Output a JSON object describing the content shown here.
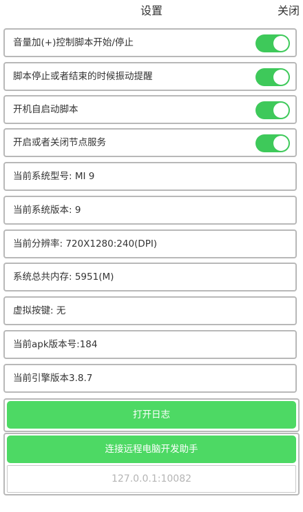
{
  "header": {
    "title": "设置",
    "close_label": "关闭"
  },
  "settings": {
    "toggles": [
      {
        "label": "音量加(+)控制脚本开始/停止",
        "on": true
      },
      {
        "label": "脚本停止或者结束的时候振动提醒",
        "on": true
      },
      {
        "label": "开机自启动脚本",
        "on": true
      },
      {
        "label": "开启或者关闭节点服务",
        "on": true
      }
    ],
    "info": [
      "当前系统型号: MI 9",
      "当前系统版本: 9",
      "当前分辨率: 720X1280:240(DPI)",
      "系统总共内存: 5951(M)",
      "虚拟按键: 无",
      "当前apk版本号:184",
      "当前引擎版本3.8.7"
    ]
  },
  "actions": {
    "open_log_label": "打开日志",
    "connect_label": "连接远程电脑开发助手",
    "address_value": "127.0.0.1:10082"
  },
  "colors": {
    "accent": "#4dd964",
    "toggle_on": "#3ec95a",
    "border": "#b8b8b8"
  }
}
